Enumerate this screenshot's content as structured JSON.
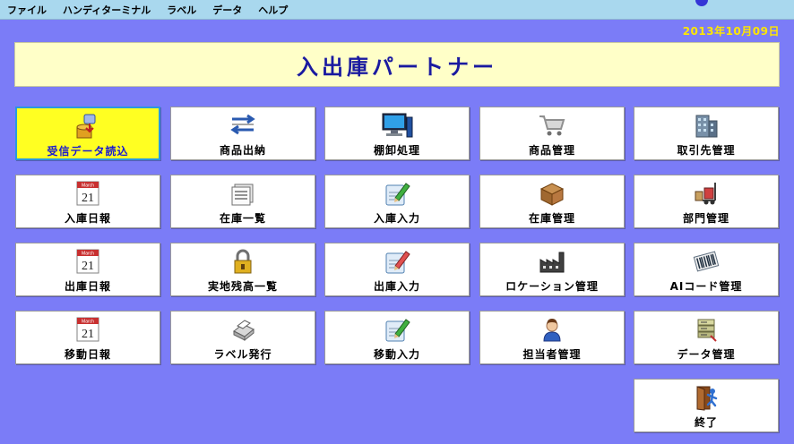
{
  "menu": [
    "ファイル",
    "ハンディターミナル",
    "ラベル",
    "データ",
    "ヘルプ"
  ],
  "date": "2013年10月09日",
  "title": "入出庫パートナー",
  "calendar_month": "March",
  "calendar_day": "21",
  "colors": {
    "background": "#7b7cf7",
    "title_text": "#1a1aa0",
    "active_tile": "#ffff22",
    "date_text": "#ffe600"
  },
  "tiles": [
    {
      "label": "受信データ読込",
      "icon": "download-data-icon"
    },
    {
      "label": "商品出納",
      "icon": "transfer-arrows-icon"
    },
    {
      "label": "棚卸処理",
      "icon": "computer-icon"
    },
    {
      "label": "商品管理",
      "icon": "shopping-cart-icon"
    },
    {
      "label": "取引先管理",
      "icon": "building-icon"
    },
    {
      "label": "入庫日報",
      "icon": "calendar-icon"
    },
    {
      "label": "在庫一覧",
      "icon": "document-list-icon"
    },
    {
      "label": "入庫入力",
      "icon": "edit-pencil-icon"
    },
    {
      "label": "在庫管理",
      "icon": "box-icon"
    },
    {
      "label": "部門管理",
      "icon": "forklift-icon"
    },
    {
      "label": "出庫日報",
      "icon": "calendar-icon"
    },
    {
      "label": "実地残高一覧",
      "icon": "lock-icon"
    },
    {
      "label": "出庫入力",
      "icon": "edit-pencil-icon"
    },
    {
      "label": "ロケーション管理",
      "icon": "factory-icon"
    },
    {
      "label": "AIコード管理",
      "icon": "barcode-icon"
    },
    {
      "label": "移動日報",
      "icon": "calendar-icon"
    },
    {
      "label": "ラベル発行",
      "icon": "printer-icon"
    },
    {
      "label": "移動入力",
      "icon": "edit-pencil-icon"
    },
    {
      "label": "担当者管理",
      "icon": "person-icon"
    },
    {
      "label": "データ管理",
      "icon": "database-icon"
    },
    {
      "label": "終了",
      "icon": "exit-door-icon"
    }
  ]
}
